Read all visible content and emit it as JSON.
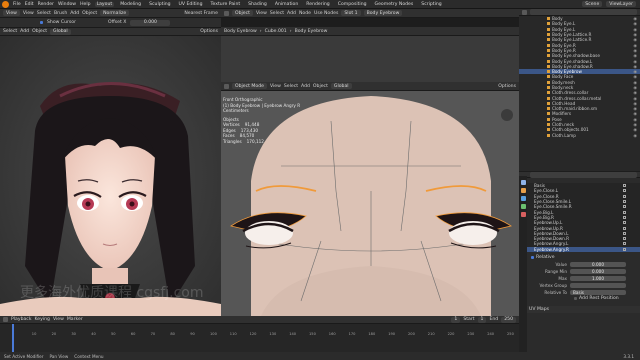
{
  "menubar": {
    "items": [
      "File",
      "Edit",
      "Render",
      "Window",
      "Help"
    ],
    "workspaces": [
      "Layout",
      "Modeling",
      "Sculpting",
      "UV Editing",
      "Texture Paint",
      "Shading",
      "Animation",
      "Rendering",
      "Compositing",
      "Geometry Nodes",
      "Scripting"
    ],
    "active_workspace": "Layout",
    "scene": "Scene",
    "view_layer": "ViewLayer"
  },
  "left_header": {
    "mode": "View",
    "menus": [
      "View",
      "Select",
      "Brush",
      "Add",
      "Object"
    ],
    "tool": "Normalize",
    "cursor_label": "Show Cursor",
    "option_label": "Nearest Frame",
    "offset_label": "Offset X",
    "offset_value": "0.000",
    "options": "Options",
    "mode2": "Global"
  },
  "mid_header": {
    "breadcrumb": [
      "Body Eyebrow",
      "Cube.001",
      "Body Eyebrow"
    ],
    "mode": "Object Mode",
    "menus": [
      "View",
      "Select",
      "Add",
      "Object"
    ],
    "transform": "Global",
    "options": "Options",
    "top_menus": [
      "Object",
      "View",
      "Select",
      "Add",
      "Node",
      "Use Nodes"
    ],
    "slot": "Slot 1",
    "material": "Body Eyebrow"
  },
  "mid_overlay": {
    "view": "Front Orthographic",
    "object": "(1) Body Eyebrow | Eyebrow Angry R",
    "unit": "Centimeters",
    "stats_title": "Objects",
    "vertices_label": "Vertices",
    "vertices": "91,448",
    "edges_label": "Edges",
    "edges": "173,430",
    "faces_label": "Faces",
    "faces": "84,570",
    "triangles_label": "Triangles",
    "triangles": "170,112"
  },
  "watermark": "更多海外优质课程 cgsfj.com",
  "outliner": {
    "rows": [
      {
        "label": "Body",
        "sel": false
      },
      {
        "label": "Body Eye.L",
        "sel": false
      },
      {
        "label": "Body Eye.L",
        "sel": false
      },
      {
        "label": "Body Eye.Lattice.R",
        "sel": false
      },
      {
        "label": "Body Eye.Lattice.R",
        "sel": false
      },
      {
        "label": "Body Eye.R",
        "sel": false
      },
      {
        "label": "Body Eye.R",
        "sel": false
      },
      {
        "label": "Body Eye.shadow.base",
        "sel": false
      },
      {
        "label": "Body Eye.shadow.L",
        "sel": false
      },
      {
        "label": "Body Eye.shadow.R",
        "sel": false
      },
      {
        "label": "Body Eyebrow",
        "sel": true
      },
      {
        "label": "Body Face",
        "sel": false
      },
      {
        "label": "Body.mesh",
        "sel": false
      },
      {
        "label": "Body.neck",
        "sel": false
      },
      {
        "label": "Cloth.dress.collar",
        "sel": false
      },
      {
        "label": "Cloth.dress.collar.metal",
        "sel": false
      },
      {
        "label": "Cloth.Head",
        "sel": false
      },
      {
        "label": "Cloth.maid.ribbon.sm",
        "sel": false
      },
      {
        "label": "Modifiers",
        "sel": false
      },
      {
        "label": "Pose",
        "sel": false
      },
      {
        "label": "Cloth.neck",
        "sel": false
      },
      {
        "label": "Cloth.objects.001",
        "sel": false
      },
      {
        "label": "Cloth.Lamp",
        "sel": false
      }
    ]
  },
  "shape_keys": {
    "rows": [
      {
        "label": "Basis",
        "sel": false
      },
      {
        "label": "Eye.Close.L",
        "sel": false
      },
      {
        "label": "Eye.Close.R",
        "sel": false
      },
      {
        "label": "Eye.Close.Smile.L",
        "sel": false
      },
      {
        "label": "Eye.Close.Smile.R",
        "sel": false
      },
      {
        "label": "Eye.Big.L",
        "sel": false
      },
      {
        "label": "Eye.Big.R",
        "sel": false
      },
      {
        "label": "Eyebrow.Up.L",
        "sel": false
      },
      {
        "label": "Eyebrow.Up.R",
        "sel": false
      },
      {
        "label": "Eyebrow.Down.L",
        "sel": false
      },
      {
        "label": "Eyebrow.Down.R",
        "sel": false
      },
      {
        "label": "Eyebrow.Angry.L",
        "sel": false
      },
      {
        "label": "Eyebrow.Angry.R",
        "sel": true
      }
    ],
    "relative_label": "Relative",
    "value_label": "Value",
    "value": "0.000",
    "range_min_label": "Range Min",
    "range_min": "0.000",
    "max_label": "Max",
    "max": "1.000",
    "vertex_group_label": "Vertex Group",
    "relative_to_label": "Relative To",
    "relative_to": "Basis",
    "rest_label": "Add Rest Position",
    "uv_label": "UV Maps"
  },
  "timeline": {
    "menus": [
      "Playback",
      "Keying",
      "View",
      "Marker"
    ],
    "ticks": [
      "0",
      "10",
      "20",
      "30",
      "40",
      "50",
      "60",
      "70",
      "80",
      "90",
      "100",
      "110",
      "120",
      "130",
      "140",
      "150",
      "160",
      "170",
      "180",
      "190",
      "200",
      "210",
      "220",
      "230",
      "240",
      "250"
    ],
    "current_frame": "1",
    "start_label": "Start",
    "start": "1",
    "end_label": "End",
    "end": "250"
  },
  "statusbar": {
    "items": [
      "Set Active Modifier",
      "Pan View",
      "Context Menu"
    ],
    "version": "3.3.1"
  }
}
